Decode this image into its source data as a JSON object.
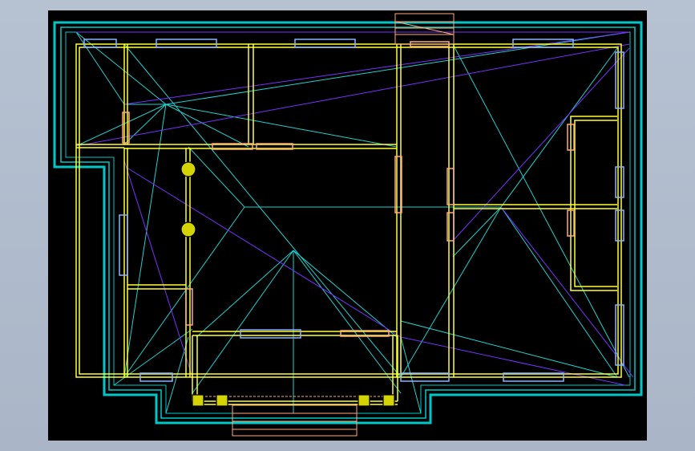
{
  "viewport": {
    "background": "#000000",
    "window_background": "#aab6c7"
  },
  "palette": {
    "roof_outline": "#00c8c8",
    "roof_ridges": "#20d0d0",
    "walls": "#ffff30",
    "doors": "#ffaa80",
    "windows": "#8ab4ff",
    "hip_lines": "#7a30ff",
    "pillars": "#d4d400",
    "chimney": "#ffaa80"
  },
  "layers": [
    "roof-outline",
    "roof-ridges",
    "hip-lines",
    "walls",
    "doors",
    "windows",
    "pillars",
    "chimney"
  ]
}
